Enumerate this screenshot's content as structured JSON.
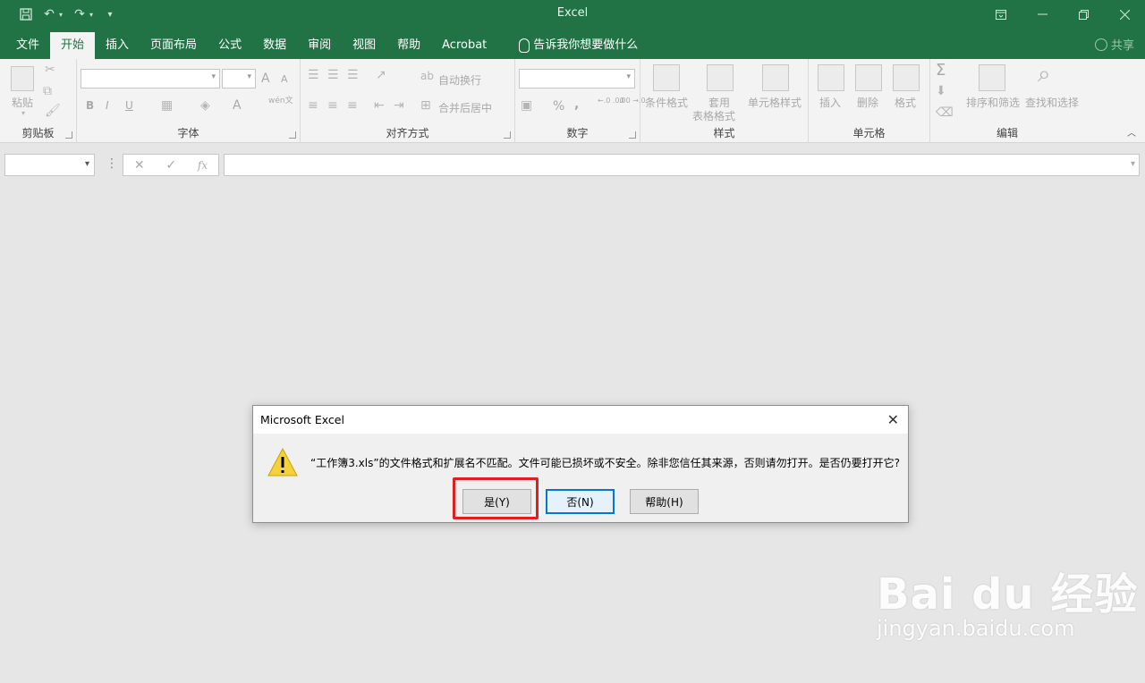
{
  "app": {
    "title": "Excel"
  },
  "ribbon_tabs": [
    {
      "label": "文件"
    },
    {
      "label": "开始"
    },
    {
      "label": "插入"
    },
    {
      "label": "页面布局"
    },
    {
      "label": "公式"
    },
    {
      "label": "数据"
    },
    {
      "label": "审阅"
    },
    {
      "label": "视图"
    },
    {
      "label": "帮助"
    },
    {
      "label": "Acrobat"
    }
  ],
  "tell_me": "告诉我你想要做什么",
  "share": "共享",
  "groups": {
    "clipboard": {
      "label": "剪贴板",
      "paste": "粘贴"
    },
    "font": {
      "label": "字体",
      "bold": "B",
      "italic": "I",
      "underline": "U",
      "grow": "A",
      "shrink": "A",
      "color": "A",
      "wen": "wén文"
    },
    "alignment": {
      "label": "对齐方式",
      "wrap": "自动换行",
      "merge": "合并后居中"
    },
    "number": {
      "label": "数字",
      "percent": "%",
      "comma": ",",
      "inc": "←.0 .00",
      "dec": ".00 →.0"
    },
    "styles": {
      "label": "样式",
      "conditional": "条件格式",
      "table_1": "套用",
      "table_2": "表格格式",
      "cell_styles": "单元格样式"
    },
    "cells": {
      "label": "单元格",
      "insert": "插入",
      "delete": "删除",
      "format": "格式"
    },
    "editing": {
      "label": "编辑",
      "sigma": "Σ",
      "sort": "排序和筛选",
      "find": "查找和选择"
    }
  },
  "formula_bar": {
    "cancel": "✕",
    "enter": "✓",
    "fx": "fx"
  },
  "dialog": {
    "title": "Microsoft Excel",
    "message": "“工作簿3.xls”的文件格式和扩展名不匹配。文件可能已损坏或不安全。除非您信任其来源，否则请勿打开。是否仍要打开它?",
    "yes": "是(Y)",
    "no": "否(N)",
    "help": "帮助(H)"
  },
  "watermark": {
    "main": "Bai du 经验",
    "sub": "jingyan.baidu.com"
  },
  "colors": {
    "excel_green": "#217346",
    "highlight_red": "#e02020",
    "focus_blue": "#0078d7"
  }
}
